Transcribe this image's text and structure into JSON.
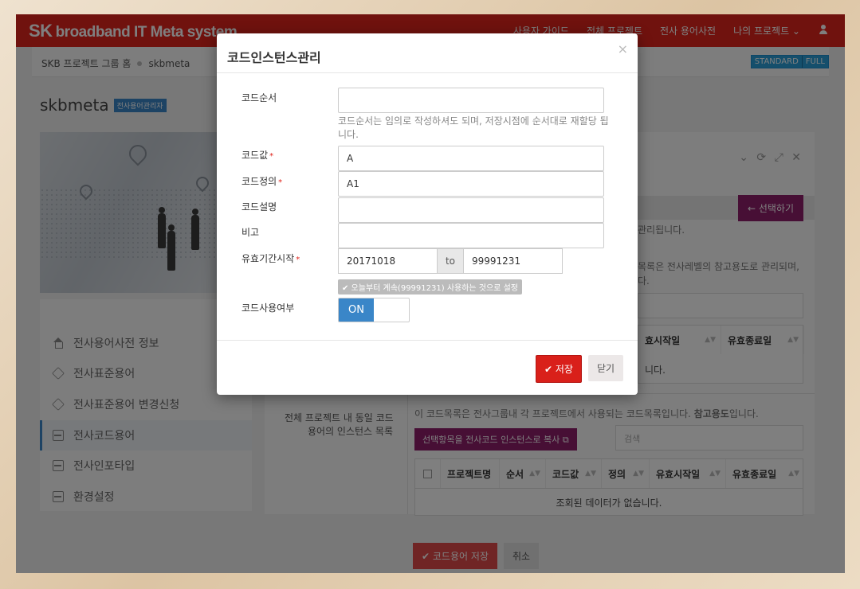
{
  "app": {
    "brand_sk": "SK",
    "brand_rest": "broadband IT Meta system"
  },
  "nav": {
    "items": [
      "사용자 가이드",
      "전체 프로젝트",
      "전사 용어사전",
      "나의 프로젝트 ⌄"
    ]
  },
  "breadcrumb": {
    "home": "SKB 프로젝트 그룹 홈",
    "current": "skbmeta"
  },
  "mode_buttons": [
    "STANDARD",
    "FULL"
  ],
  "page": {
    "title": "skbmeta",
    "badge": "전사용어관리자"
  },
  "sidebar": {
    "items": [
      {
        "label": "전사용어사전 정보",
        "icon": "home-icon"
      },
      {
        "label": "전사표준용어",
        "icon": "layers-icon"
      },
      {
        "label": "전사표준용어 변경신청",
        "icon": "layers-icon"
      },
      {
        "label": "전사코드용어",
        "icon": "inbox-icon"
      },
      {
        "label": "전사인포타입",
        "icon": "inbox-icon"
      },
      {
        "label": "환경설정",
        "icon": "inbox-icon"
      }
    ]
  },
  "main": {
    "select_button": "← 선택하기",
    "managed_text": "관리됩니다.",
    "ref_text_1": "목록은 전사레벨의 참고용도로 관리되며,",
    "ref_text_2": "다.",
    "table1_headers": [
      "효시작일",
      "유효종료일"
    ],
    "table1_empty": "니다.",
    "instance_label_1": "전체 프로젝트 내 동일 코드",
    "instance_label_2": "용어의 인스턴스 목록",
    "instance_desc_a": "이 코드목록은 전사그룹내 각 프로젝트에서 사용되는 코드목록입니다. ",
    "instance_desc_b": "참고용도",
    "instance_desc_c": "입니다.",
    "copy_button": "선택항목을 전사코드 인스턴스로 복사 ⧉",
    "search_placeholder": "검색",
    "table2_headers": [
      "프로젝트명",
      "순서",
      "코드값",
      "정의",
      "유효시작일",
      "유효종료일"
    ],
    "table2_empty": "조회된 데이터가 없습니다.",
    "save_button": "✔ 코드용어 저장",
    "cancel_button": "취소"
  },
  "modal": {
    "title": "코드인스턴스관리",
    "close": "×",
    "fields": {
      "order_label": "코드순서",
      "order_value": "",
      "order_hint": "코드순서는 임의로 작성하셔도 되며, 저장시점에 순서대로 재할당 됩니다.",
      "value_label": "코드값",
      "value_value": "A",
      "def_label": "코드정의",
      "def_value": "A1",
      "desc_label": "코드설명",
      "desc_value": "",
      "note_label": "비고",
      "note_value": "",
      "period_label": "유효기간시작",
      "period_from": "20171018",
      "period_to_label": "to",
      "period_to": "99991231",
      "forever_button": "✔ 오늘부터 계속(99991231) 사용하는 것으로 설정",
      "use_label": "코드사용여부",
      "use_value": "ON"
    },
    "save_button": "✔ 저장",
    "close_button": "닫기"
  }
}
